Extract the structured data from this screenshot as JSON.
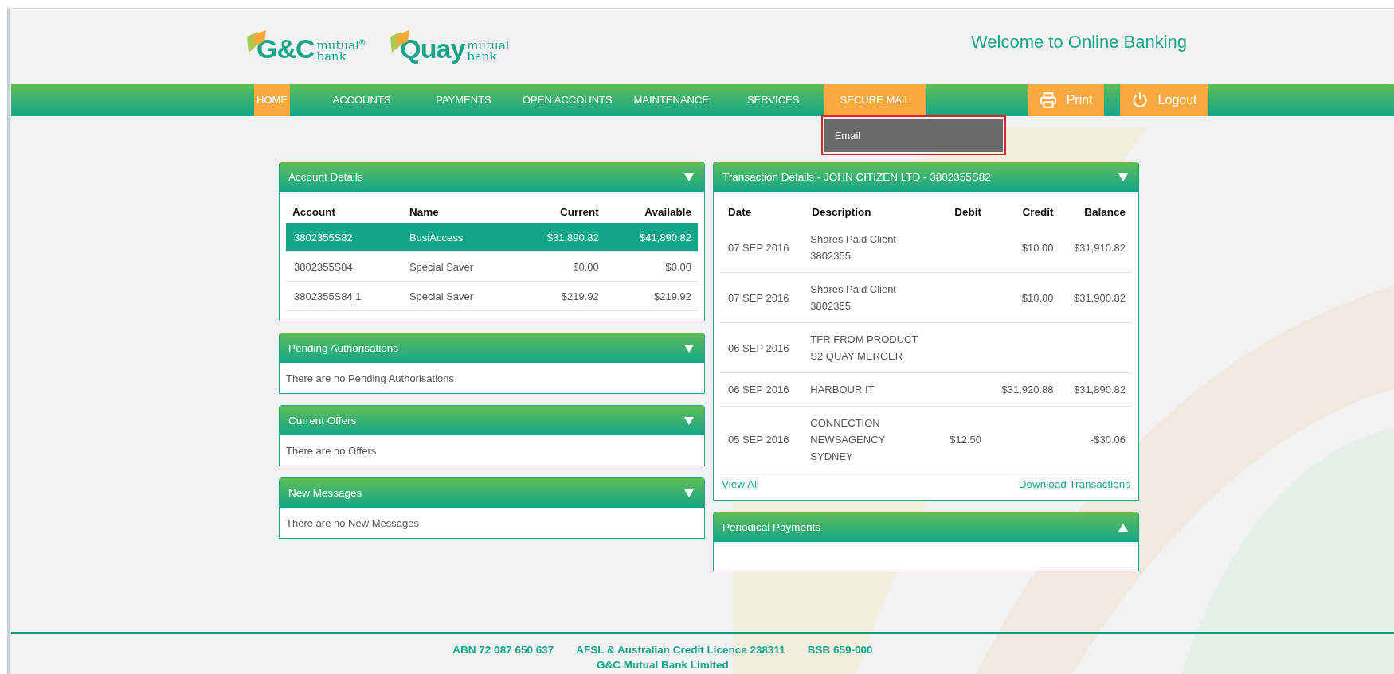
{
  "header": {
    "logos": [
      {
        "name": "G&C",
        "line1": "mutual",
        "line2": "bank",
        "mark": "®"
      },
      {
        "name": "Quay",
        "line1": "mutual",
        "line2": "bank"
      }
    ],
    "welcome": "Welcome to Online Banking"
  },
  "nav": {
    "items": [
      {
        "label": "HOME",
        "selected": true,
        "expanded": false
      },
      {
        "label": "ACCOUNTS",
        "selected": false,
        "expanded": false
      },
      {
        "label": "PAYMENTS",
        "selected": false,
        "expanded": false
      },
      {
        "label": "OPEN ACCOUNTS",
        "selected": false,
        "expanded": false
      },
      {
        "label": "MAINTENANCE",
        "selected": false,
        "expanded": false
      },
      {
        "label": "SERVICES",
        "selected": false,
        "expanded": false
      },
      {
        "label": "SECURE MAIL",
        "selected": false,
        "expanded": true
      }
    ],
    "dropdown": [
      {
        "label": "Email",
        "annotated": true
      }
    ],
    "print": "Print",
    "logout": "Logout"
  },
  "account_details": {
    "title": "Account Details",
    "expanded": true,
    "columns": [
      "Account",
      "Name",
      "Current",
      "Available"
    ],
    "rows": [
      {
        "cells": [
          "3802355S82",
          "BusiAccess",
          "$31,890.82",
          "$41,890.82"
        ],
        "selected": true
      },
      {
        "cells": [
          "3802355S84",
          "Special Saver",
          "$0.00",
          "$0.00"
        ],
        "selected": false
      },
      {
        "cells": [
          "3802355S84.1",
          "Special Saver",
          "$219.92",
          "$219.92"
        ],
        "selected": false
      }
    ]
  },
  "pending": {
    "title": "Pending Authorisations",
    "expanded": true,
    "message": "There are no Pending Authorisations"
  },
  "offers": {
    "title": "Current Offers",
    "expanded": true,
    "message": "There are no Offers"
  },
  "messages": {
    "title": "New Messages",
    "expanded": true,
    "message": "There are no New Messages"
  },
  "transactions": {
    "title": "Transaction Details - JOHN CITIZEN LTD - 3802355S82",
    "expanded": true,
    "columns": [
      "Date",
      "Description",
      "Debit",
      "Credit",
      "Balance"
    ],
    "rows": [
      {
        "date": "07 SEP 2016",
        "description": [
          "Shares Paid Client",
          "3802355"
        ],
        "debit": "",
        "credit": "$10.00",
        "balance": "$31,910.82"
      },
      {
        "date": "07 SEP 2016",
        "description": [
          "Shares Paid Client",
          "3802355"
        ],
        "debit": "",
        "credit": "$10.00",
        "balance": "$31,900.82"
      },
      {
        "date": "06 SEP 2016",
        "description": [
          "TFR FROM PRODUCT",
          "S2 QUAY MERGER"
        ],
        "debit": "",
        "credit": "",
        "balance": ""
      },
      {
        "date": "06 SEP 2016",
        "description": [
          "HARBOUR IT"
        ],
        "debit": "",
        "credit": "$31,920.88",
        "balance": "$31,890.82"
      },
      {
        "date": "05 SEP 2016",
        "description": [
          "CONNECTION",
          "NEWSAGENCY",
          "SYDNEY"
        ],
        "debit": "$12.50",
        "credit": "",
        "balance": "-$30.06"
      }
    ],
    "view_all": "View All",
    "download": "Download Transactions"
  },
  "periodical": {
    "title": "Periodical Payments",
    "expanded": false
  },
  "footer": {
    "items": [
      "ABN 72 087 650 637",
      "AFSL & Australian Credit Licence 238311",
      "BSB 659-000"
    ],
    "company": "G&C Mutual Bank Limited"
  }
}
